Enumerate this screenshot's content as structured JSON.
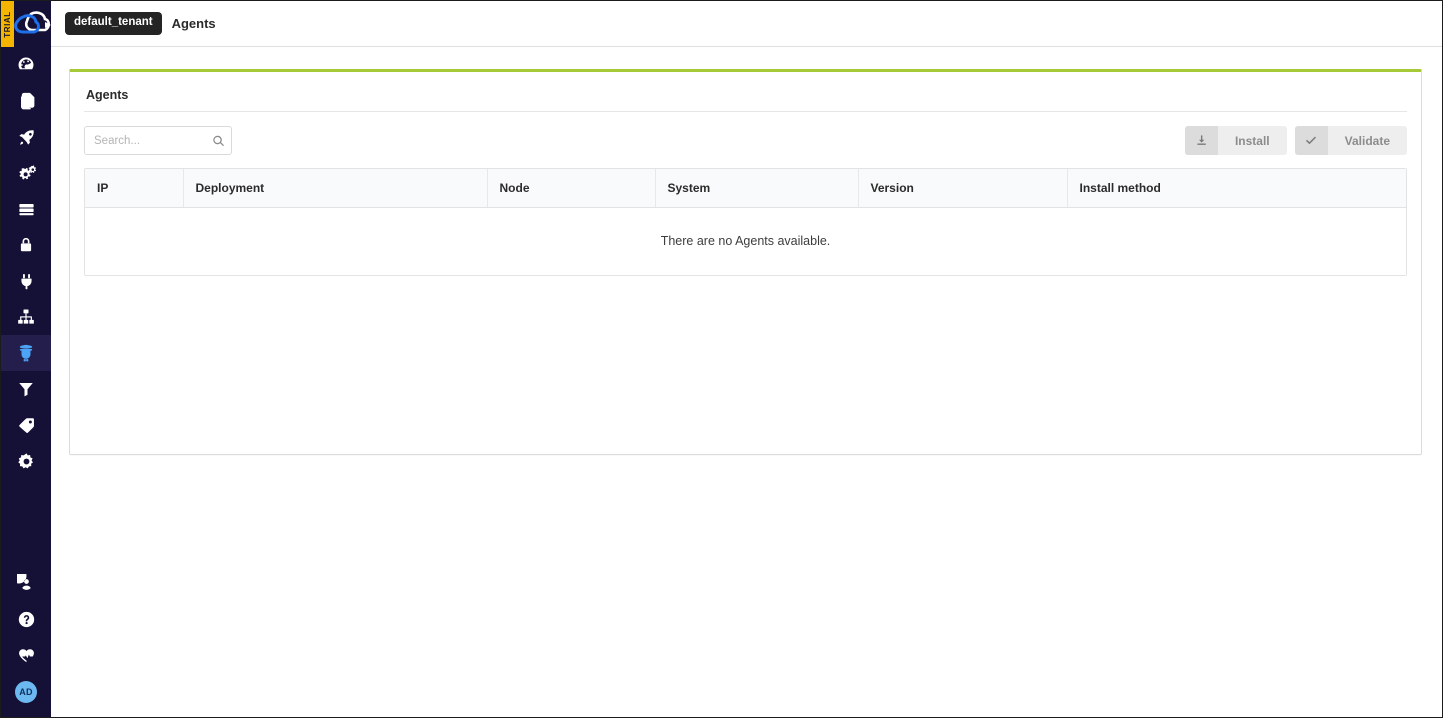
{
  "brand": {
    "trial_label": "TRIAL",
    "logo_name": "cloudify-cloud-logo",
    "accent_color": "#a6c937",
    "sidebar_color": "#141036",
    "active_icon_color": "#4da3f5"
  },
  "topbar": {
    "tenant_badge": "default_tenant",
    "page_name": "Agents"
  },
  "sidebar": {
    "items": [
      {
        "icon": "dashboard-gauge-icon",
        "label": "Dashboard",
        "active": false
      },
      {
        "icon": "blueprints-pages-icon",
        "label": "Blueprints",
        "active": false
      },
      {
        "icon": "deployments-rocket-icon",
        "label": "Deployments",
        "active": false
      },
      {
        "icon": "services-gears-icon",
        "label": "Services",
        "active": false
      },
      {
        "icon": "nodes-server-icon",
        "label": "Nodes",
        "active": false
      },
      {
        "icon": "secrets-lock-icon",
        "label": "Secrets",
        "active": false
      },
      {
        "icon": "plugins-plug-icon",
        "label": "Plugins",
        "active": false
      },
      {
        "icon": "sites-hierarchy-icon",
        "label": "Sites",
        "active": false
      },
      {
        "icon": "agents-spy-icon",
        "label": "Agents",
        "active": true
      },
      {
        "icon": "filters-funnel-icon",
        "label": "Filters",
        "active": false
      },
      {
        "icon": "labels-tag-icon",
        "label": "Labels",
        "active": false
      },
      {
        "icon": "settings-gear-icon",
        "label": "System Settings",
        "active": false
      }
    ],
    "bottom_items": [
      {
        "icon": "user-account-icon",
        "label": "Account"
      },
      {
        "icon": "help-question-icon",
        "label": "Help"
      },
      {
        "icon": "health-pulse-icon",
        "label": "Status"
      }
    ],
    "avatar_initials": "AD"
  },
  "panel": {
    "title": "Agents",
    "search": {
      "value": "",
      "placeholder": "Search...",
      "icon": "search-icon"
    },
    "buttons": [
      {
        "label": "Install",
        "icon": "download-install-icon",
        "disabled": true
      },
      {
        "label": "Validate",
        "icon": "check-validate-icon",
        "disabled": true
      }
    ],
    "table": {
      "columns": [
        "IP",
        "Deployment",
        "Node",
        "System",
        "Version",
        "Install method"
      ],
      "rows": [],
      "empty_message": "There are no Agents available."
    }
  }
}
